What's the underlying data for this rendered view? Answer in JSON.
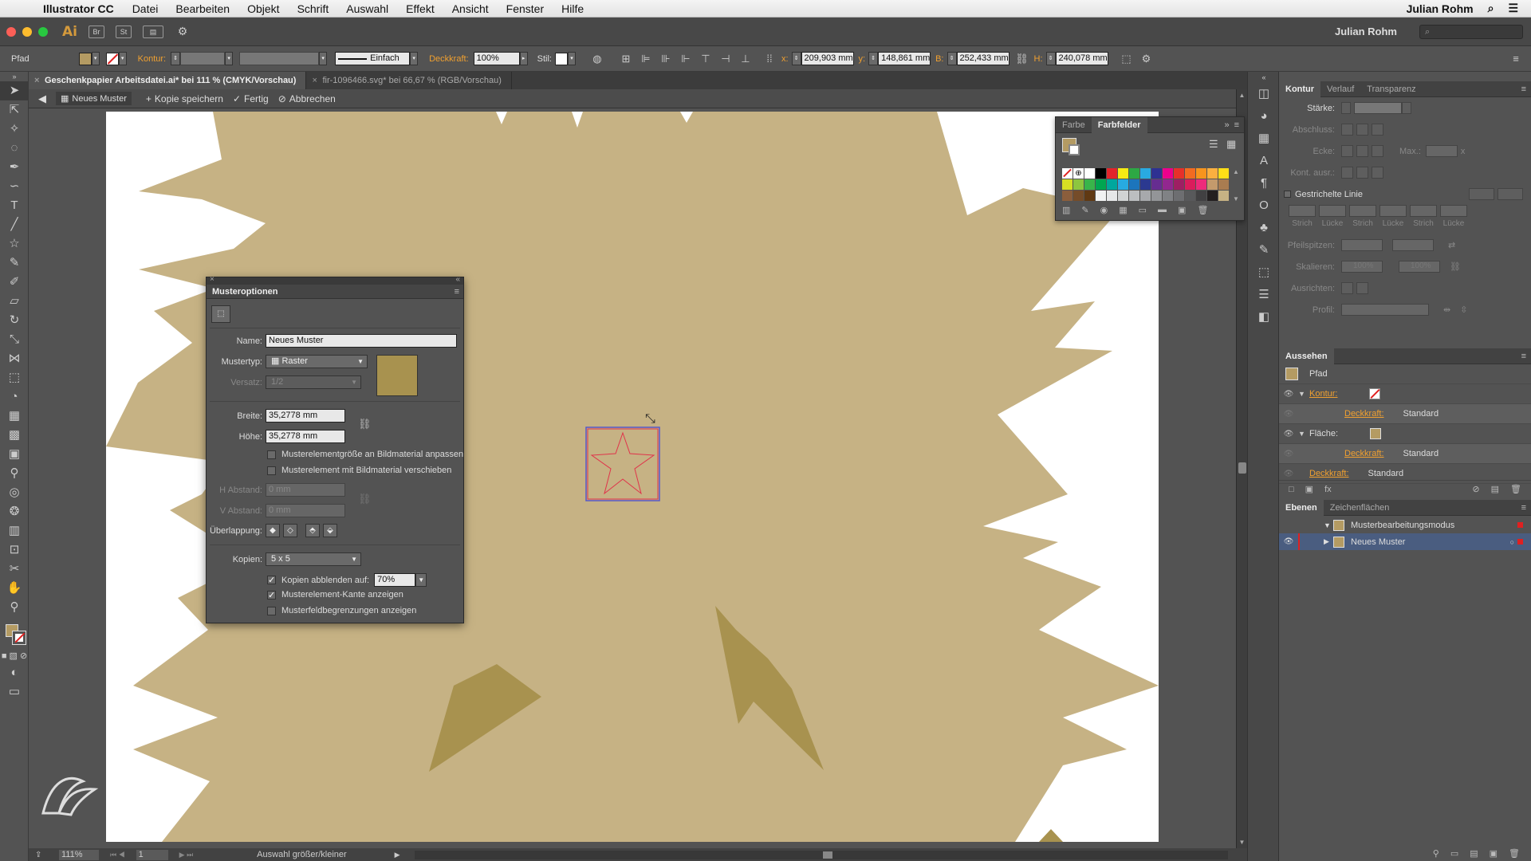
{
  "menubar": {
    "app_name": "Illustrator CC",
    "items": [
      "Datei",
      "Bearbeiten",
      "Objekt",
      "Schrift",
      "Auswahl",
      "Effekt",
      "Ansicht",
      "Fenster",
      "Hilfe"
    ],
    "user": "Julian Rohm"
  },
  "appbar": {
    "logo": "Ai",
    "btn_br": "Br",
    "btn_st": "St",
    "user": "Julian Rohm"
  },
  "controlbar": {
    "object_type": "Pfad",
    "kontur_label": "Kontur:",
    "stroke_style": "Einfach",
    "deckkraft_label": "Deckkraft:",
    "deckkraft_value": "100%",
    "stil_label": "Stil:",
    "x_label": "x:",
    "x_value": "209,903 mm",
    "y_label": "y:",
    "y_value": "148,861 mm",
    "b_label": "B:",
    "b_value": "252,433 mm",
    "h_label": "H:",
    "h_value": "240,078 mm"
  },
  "tabs": [
    {
      "label": "Geschenkpapier Arbeitsdatei.ai* bei 111 % (CMYK/Vorschau)",
      "active": true
    },
    {
      "label": "fir-1096466.svg* bei 66,67 % (RGB/Vorschau)",
      "active": false
    }
  ],
  "isolation": {
    "pattern_name": "Neues Muster",
    "save_copy": "Kopie speichern",
    "done": "Fertig",
    "cancel": "Abbrechen"
  },
  "dialog": {
    "title": "Musteroptionen",
    "name_label": "Name:",
    "name_value": "Neues Muster",
    "type_label": "Mustertyp:",
    "type_value": "Raster",
    "offset_label": "Versatz:",
    "offset_value": "1/2",
    "width_label": "Breite:",
    "width_value": "35,2778 mm",
    "height_label": "Höhe:",
    "height_value": "35,2778 mm",
    "fit_label": "Musterelementgröße an Bildmaterial anpassen",
    "move_label": "Musterelement mit Bildmaterial verschieben",
    "hspacing_label": "H Abstand:",
    "hspacing_value": "0 mm",
    "vspacing_label": "V Abstand:",
    "vspacing_value": "0 mm",
    "overlap_label": "Überlappung:",
    "copies_label": "Kopien:",
    "copies_value": "5 x 5",
    "dim_label": "Kopien abblenden auf:",
    "dim_value": "70%",
    "edge_label": "Musterelement-Kante anzeigen",
    "bounds_label": "Musterfeldbegrenzungen anzeigen",
    "fit_checked": false,
    "move_checked": false,
    "dim_checked": true,
    "edge_checked": true,
    "bounds_checked": false,
    "swatch_color": "#a8924f"
  },
  "swatch_panel": {
    "tab_farbe": "Farbe",
    "tab_farbfelder": "Farbfelder"
  },
  "kontur_panel": {
    "tabs": [
      "Kontur",
      "Verlauf",
      "Transparenz"
    ],
    "staerke": "Stärke:",
    "abschluss": "Abschluss:",
    "ecke": "Ecke:",
    "max": "Max.:",
    "max_suffix": "x",
    "kont_ausr": "Kont. ausr.:",
    "gestrichelte": "Gestrichelte Linie",
    "dash_labels": [
      "Strich",
      "Lücke",
      "Strich",
      "Lücke",
      "Strich",
      "Lücke"
    ],
    "pfeilspitzen": "Pfeilspitzen:",
    "skalieren": "Skalieren:",
    "skal_value": "100%",
    "ausrichten": "Ausrichten:",
    "profil": "Profil:"
  },
  "aussehen_panel": {
    "title": "Aussehen",
    "object": "Pfad",
    "kontur": "Kontur:",
    "deckkraft": "Deckkraft:",
    "standard": "Standard",
    "flaeche": "Fläche:"
  },
  "layers_panel": {
    "tabs": [
      "Ebenen",
      "Zeichenflächen"
    ],
    "layers": [
      "Musterbearbeitungsmodus",
      "Neues Muster"
    ]
  },
  "statusbar": {
    "zoom": "111%",
    "page": "1",
    "status": "Auswahl größer/kleiner"
  },
  "colors": {
    "artwork": "#c6b284",
    "artwork_dark": "#a8924f",
    "tile_stroke": "#e0334a",
    "tile_border": "#5757c8",
    "accent": "#f0a030"
  }
}
